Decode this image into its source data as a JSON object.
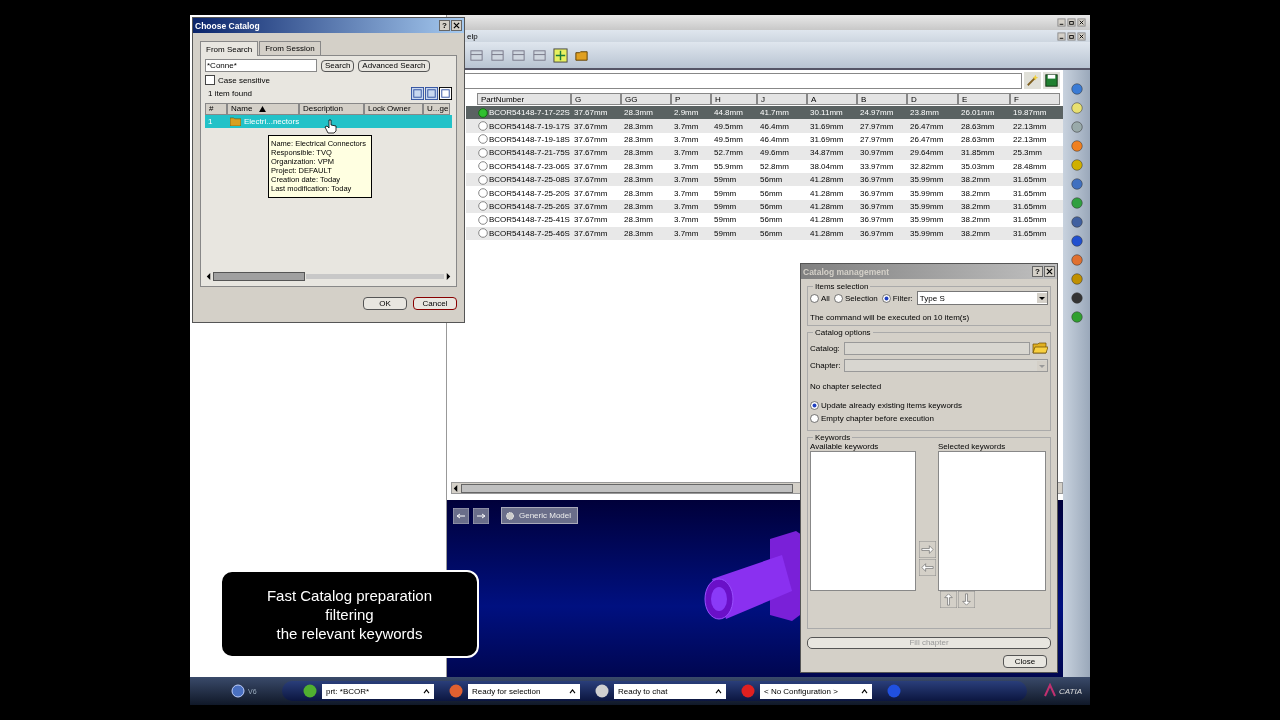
{
  "choose_catalog": {
    "title": "Choose Catalog",
    "help": "?",
    "tabs": [
      {
        "label": "From Search",
        "selected": true
      },
      {
        "label": "From Session",
        "selected": false
      }
    ],
    "search": {
      "value": "*Conne*"
    },
    "search_button": "Search",
    "advanced_button": "Advanced Search",
    "case_sensitive": {
      "label": "Case sensitive",
      "checked": false
    },
    "result_count": "1 item found",
    "view_buttons": [
      {
        "selected": false
      },
      {
        "selected": false
      },
      {
        "selected": true
      }
    ],
    "columns": [
      {
        "label": "#",
        "sorted": false
      },
      {
        "label": "Name",
        "sorted": true
      },
      {
        "label": "Description",
        "sorted": false
      },
      {
        "label": "Lock Owner",
        "sorted": false
      },
      {
        "label": "U...ge",
        "sorted": false
      }
    ],
    "rows": [
      {
        "index": "1",
        "name": "Electri...nectors",
        "selected": true
      }
    ],
    "tooltip": [
      "Name: Electrical Connectors",
      "Responsible: TVQ",
      "Organization: VPM",
      "Project: DEFAULT",
      "Creation date: Today",
      "Last modification: Today"
    ],
    "ok": "OK",
    "cancel": "Cancel"
  },
  "app": {
    "menu_fragment": "elp",
    "table": {
      "columns": [
        "PartNumber",
        "G",
        "GG",
        "P",
        "H",
        "J",
        "A",
        "B",
        "D",
        "E",
        "F"
      ],
      "rows": [
        {
          "part_number": "BCOR54148-7-17-22S",
          "values": [
            "37.67mm",
            "28.3mm",
            "2.9mm",
            "44.8mm",
            "41.7mm",
            "30.11mm",
            "24.97mm",
            "23.8mm",
            "26.01mm",
            "19.87mm"
          ],
          "selected": true
        },
        {
          "part_number": "BCOR54148-7-19-17S",
          "values": [
            "37.67mm",
            "28.3mm",
            "3.7mm",
            "49.5mm",
            "46.4mm",
            "31.69mm",
            "27.97mm",
            "26.47mm",
            "28.63mm",
            "22.13mm"
          ],
          "selected": false
        },
        {
          "part_number": "BCOR54148-7-19-18S",
          "values": [
            "37.67mm",
            "28.3mm",
            "3.7mm",
            "49.5mm",
            "46.4mm",
            "31.69mm",
            "27.97mm",
            "26.47mm",
            "28.63mm",
            "22.13mm"
          ],
          "selected": false
        },
        {
          "part_number": "BCOR54148-7-21-75S",
          "values": [
            "37.67mm",
            "28.3mm",
            "3.7mm",
            "52.7mm",
            "49.6mm",
            "34.87mm",
            "30.97mm",
            "29.64mm",
            "31.85mm",
            "25.3mm"
          ],
          "selected": false
        },
        {
          "part_number": "BCOR54148-7-23-06S",
          "values": [
            "37.67mm",
            "28.3mm",
            "3.7mm",
            "55.9mm",
            "52.8mm",
            "38.04mm",
            "33.97mm",
            "32.82mm",
            "35.03mm",
            "28.48mm"
          ],
          "selected": false
        },
        {
          "part_number": "BCOR54148-7-25-08S",
          "values": [
            "37.67mm",
            "28.3mm",
            "3.7mm",
            "59mm",
            "56mm",
            "41.28mm",
            "36.97mm",
            "35.99mm",
            "38.2mm",
            "31.65mm"
          ],
          "selected": false
        },
        {
          "part_number": "BCOR54148-7-25-20S",
          "values": [
            "37.67mm",
            "28.3mm",
            "3.7mm",
            "59mm",
            "56mm",
            "41.28mm",
            "36.97mm",
            "35.99mm",
            "38.2mm",
            "31.65mm"
          ],
          "selected": false
        },
        {
          "part_number": "BCOR54148-7-25-26S",
          "values": [
            "37.67mm",
            "28.3mm",
            "3.7mm",
            "59mm",
            "56mm",
            "41.28mm",
            "36.97mm",
            "35.99mm",
            "38.2mm",
            "31.65mm"
          ],
          "selected": false
        },
        {
          "part_number": "BCOR54148-7-25-41S",
          "values": [
            "37.67mm",
            "28.3mm",
            "3.7mm",
            "59mm",
            "56mm",
            "41.28mm",
            "36.97mm",
            "35.99mm",
            "38.2mm",
            "31.65mm"
          ],
          "selected": false
        },
        {
          "part_number": "BCOR54148-7-25-46S",
          "values": [
            "37.67mm",
            "28.3mm",
            "3.7mm",
            "59mm",
            "56mm",
            "41.28mm",
            "36.97mm",
            "35.99mm",
            "38.2mm",
            "31.65mm"
          ],
          "selected": false
        }
      ]
    },
    "viewport": {
      "model_button": "Generic Model"
    }
  },
  "catalog_management": {
    "title": "Catalog management",
    "help": "?",
    "items_selection": {
      "legend": "Items selection",
      "options": [
        {
          "label": "All",
          "selected": false
        },
        {
          "label": "Selection",
          "selected": false
        },
        {
          "label": "Filter:",
          "selected": true
        }
      ],
      "filter_value": "Type S",
      "note": "The command will be executed on 10 item(s)"
    },
    "catalog_options": {
      "legend": "Catalog options",
      "catalog_label": "Catalog:",
      "chapter_label": "Chapter:",
      "status": "No chapter selected",
      "options": [
        {
          "label": "Update already existing items keywords",
          "selected": true
        },
        {
          "label": "Empty chapter before execution",
          "selected": false
        }
      ]
    },
    "keywords": {
      "legend": "Keywords",
      "available_label": "Available keywords",
      "selected_label": "Selected keywords"
    },
    "fill_button": {
      "label": "Fill chapter",
      "disabled": true
    },
    "close_button": "Close"
  },
  "taskbar": {
    "logo": "V6",
    "fields": [
      "prt: *BCOR*",
      "Ready for selection",
      "Ready to chat",
      "< No Configuration >"
    ],
    "brand": "CATIA"
  },
  "caption": {
    "lines": [
      "Fast Catalog preparation",
      "filtering",
      "the relevant keywords"
    ]
  }
}
